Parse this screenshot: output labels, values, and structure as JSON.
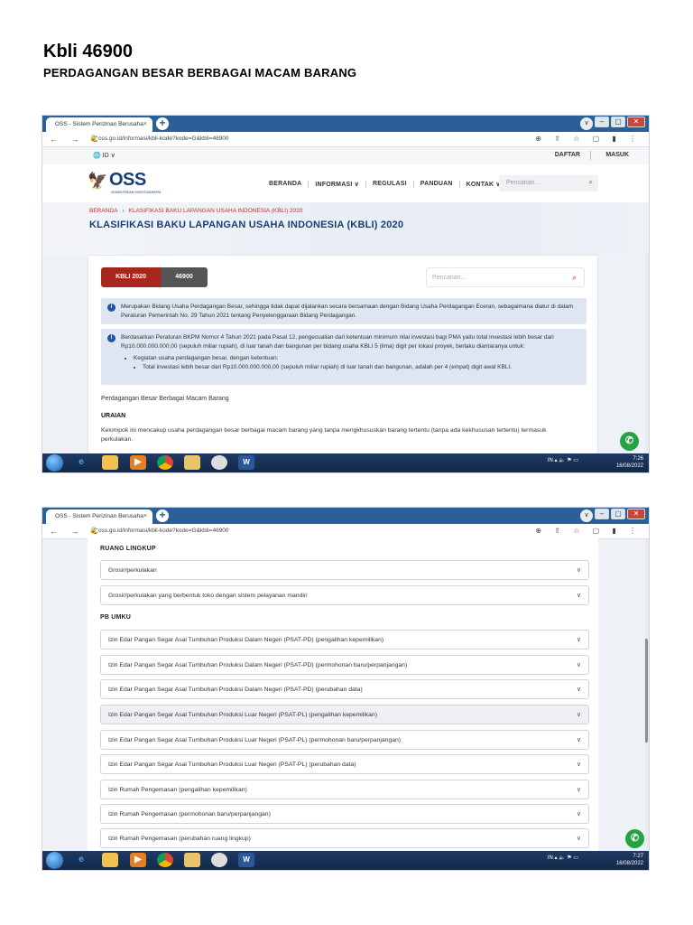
{
  "doc": {
    "title": "Kbli 46900",
    "subtitle": "PERDAGANGAN BESAR BERBAGAI MACAM BARANG"
  },
  "browser": {
    "tab_title": "OSS - Sistem Perizinan Berusaha",
    "tab_close": "×",
    "new_tab": "+",
    "url": "oss.go.id/informasi/kbli-kode?kode=G&kbli=46900",
    "nav": "← → C",
    "addr_icons": "⊕ ⇪ ☆ ▢ ▮ ⋮",
    "win_buttons": [
      "–",
      "▢",
      "✕"
    ]
  },
  "site": {
    "lang": "ID",
    "daftar": "DAFTAR",
    "masuk": "MASUK",
    "logo_text": "OSS",
    "logo_tagline": "KEMENTERIAN INVESTASI/BKPM",
    "menu": [
      "BERANDA",
      "INFORMASI ∨",
      "REGULASI",
      "PANDUAN",
      "KONTAK ∨"
    ],
    "search_placeholder": "Pencarian...",
    "breadcrumb": [
      "BERANDA",
      "KLASIFIKASI BAKU LAPANGAN USAHA INDONESIA (KBLI) 2020"
    ],
    "hero_title": "KLASIFIKASI BAKU LAPANGAN USAHA INDONESIA (KBLI) 2020"
  },
  "card": {
    "pill_a": "KBLI 2020",
    "pill_b": "46900",
    "search_placeholder": "Pencarian...",
    "info1": "Merupakan Bidang Usaha Perdagangan Besar, sehingga tidak dapat dijalankan secara bersamaan dengan Bidang Usaha Perdagangan Eceran, sebagaimana diatur di dalam Peraturan Pemerintah No. 29 Tahun 2021 tentang Penyelenggaraan Bidang Perdagangan.",
    "info2": "Berdasarkan Peraturan BKPM Nomor 4 Tahun 2021 pada Pasal 12, pengecualian dari ketentuan minimum nilai investasi bagi PMA yaitu total investasi lebih besar dari Rp10.000.000.000,00 (sepuluh miliar rupiah), di luar tanah dan bangunan per bidang usaha KBLI 5 (lima) digit per lokasi proyek, berlaku diantaranya untuk:",
    "info2_b1": "Kegiatan usaha perdagangan besar, dengan ketentuan:",
    "info2_b2": "Total investasi lebih besar dari Rp10.000.000.000,00 (sepuluh miliar rupiah) di luar tanah dan bangunan, adalah per 4 (empat) digit awal KBLI.",
    "kbli_name": "Perdagangan Besar Berbagai Macam Barang",
    "uraian_h": "URAIAN",
    "uraian_t": "Kelompok ini mencakup usaha perdagangan besar berbagai macam barang yang tanpa mengkhususkan barang tertentu (tanpa ada kekhususan tertentu) termasuk perkulakan."
  },
  "taskbar": {
    "tray_lang": "IN",
    "shot1_time": "7:26",
    "shot1_date": "16/08/2022",
    "shot2_time": "7:27",
    "shot2_date": "16/08/2022",
    "word": "W"
  },
  "list": {
    "ruang_lingkup": "RUANG LINGKUP",
    "ruang_items": [
      "Grosir/perkulakan",
      "Grosir/perkulakan yang berbentuk toko dengan sistem pelayanan mandiri"
    ],
    "pb_umku": "PB UMKU",
    "pb_items": [
      "Izin Edar Pangan Segar Asal Tumbuhan Produksi Dalam Negeri (PSAT-PD) (pengalihan kepemilikan)",
      "Izin Edar Pangan Segar Asal Tumbuhan Produksi Dalam Negeri (PSAT-PD) (permohonan baru/perpanjangan)",
      "Izin Edar Pangan Segar Asal Tumbuhan Produksi Dalam Negeri (PSAT-PD) (perubahan data)",
      "Izin Edar Pangan Segar Asal Tumbuhan Produksi Luar Negeri (PSAT-PL) (pengalihan kepemilikan)",
      "Izin Edar Pangan Segar Asal Tumbuhan Produksi Luar Negeri (PSAT-PL) (permohonan baru/perpanjangan)",
      "Izin Edar Pangan Segar Asal Tumbuhan Produksi Luar Negeri (PSAT-PL) (perubahan data)",
      "Izin Rumah Pengemasan (pengalihan kepemilikan)",
      "Izin Rumah Pengemasan (permohonan baru/perpanjangan)",
      "Izin Rumah Pengemasan (perubahan ruang lingkup)"
    ]
  }
}
